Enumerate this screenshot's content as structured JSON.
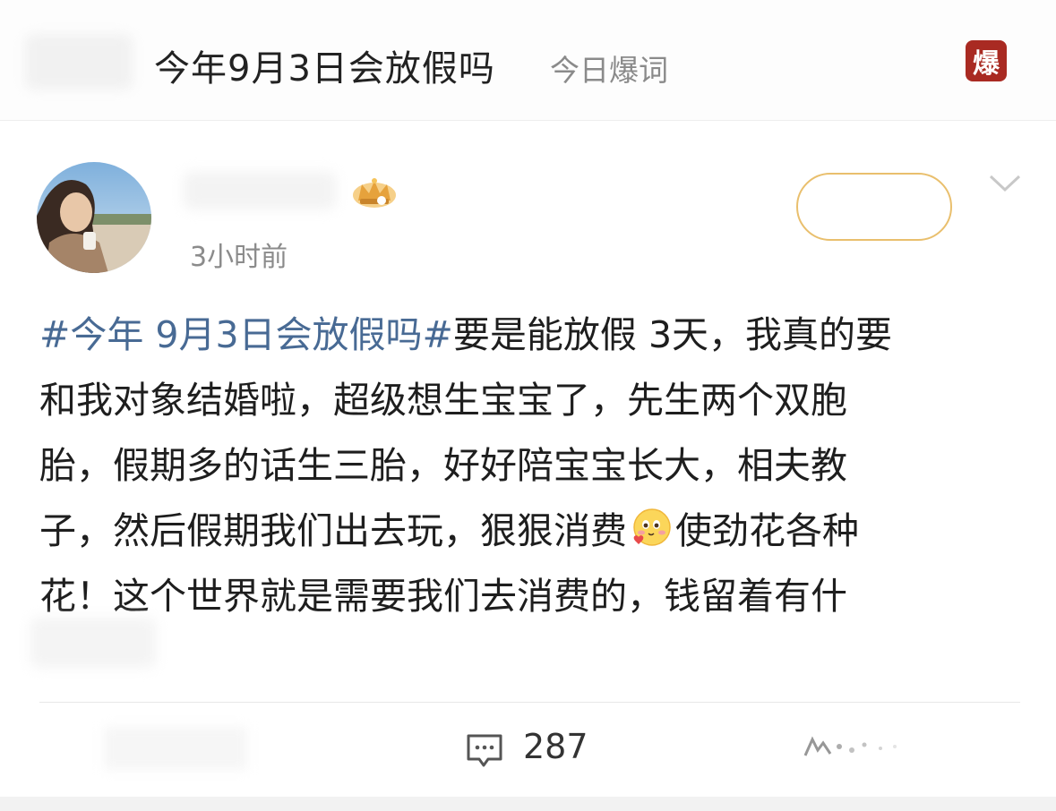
{
  "header": {
    "topic_title": "今年9月3日会放假吗",
    "topic_sub": "今日爆词",
    "hot_badge": "爆"
  },
  "post": {
    "time": "3小时前",
    "lines": [
      {
        "hashtag": "#今年 9月3日会放假吗#",
        "text": "要是能放假 3天，我真的要"
      },
      {
        "text": "和我对象结婚啦，超级想生宝宝了，先生两个双胞"
      },
      {
        "text": "胎，假期多的话生三胎，好好陪宝宝长大，相夫教"
      },
      {
        "text": "子，然后假期我们出去玩，狠狠消费",
        "emoji": "blush-heart-emoji-icon",
        "after": "使劲花各种"
      },
      {
        "text": "花！这个世界就是需要我们去消费的，钱留着有什"
      }
    ]
  },
  "actions": {
    "comment_icon": "comment-icon",
    "comment_count": "287"
  },
  "colors": {
    "hashtag": "#486a94",
    "hot_badge": "#a92a22",
    "follow_border": "#e9bf6d"
  }
}
